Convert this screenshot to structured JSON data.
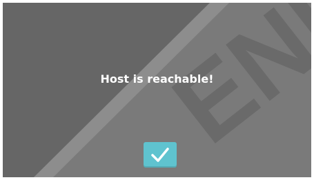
{
  "dialog": {
    "message": "Host is reachable!",
    "watermark_text": "END",
    "confirm_icon": "checkmark-icon",
    "colors": {
      "background_dark": "#666666",
      "background_light": "#7a7a7a",
      "stripe": "#8d8d8d",
      "button": "#5fc3cf",
      "text": "#ffffff"
    }
  }
}
